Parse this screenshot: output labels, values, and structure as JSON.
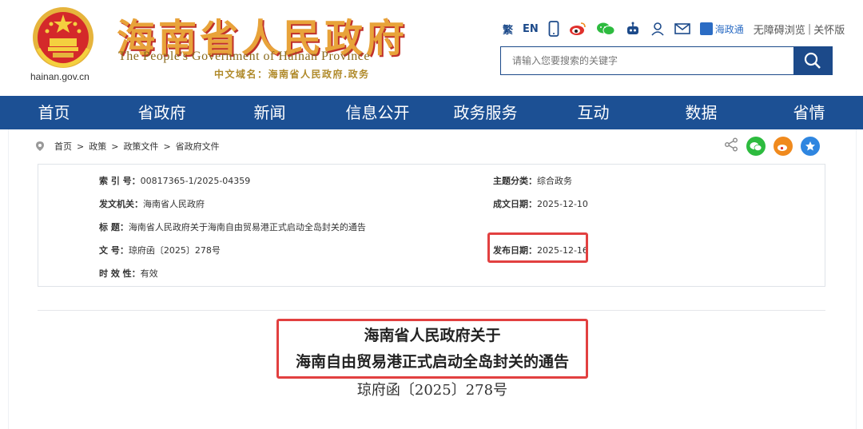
{
  "header": {
    "title_cn": "海南省人民政府",
    "title_en": "The People's Government  of Hainan Province",
    "domain_cn": "中文域名：海南省人民政府.政务",
    "domain_small": "hainan.gov.cn"
  },
  "topbar": {
    "trad": "繁",
    "en": "EN",
    "hzt_label": "海政通",
    "accessibility": "无障碍浏览",
    "separator": "|",
    "elder_mode": "关怀版"
  },
  "search": {
    "placeholder": "请输入您要搜索的关键字"
  },
  "nav": {
    "items": [
      "首页",
      "省政府",
      "新闻",
      "信息公开",
      "政务服务",
      "互动",
      "数据",
      "省情"
    ]
  },
  "breadcrumb": {
    "items": [
      "首页",
      "政策",
      "政策文件",
      "省政府文件"
    ],
    "sep": ">"
  },
  "meta": {
    "index_label": "索  引  号：",
    "index_value": "00817365-1/2025-04359",
    "category_label": "主题分类：",
    "category_value": "综合政务",
    "issuer_label": "发文机关：",
    "issuer_value": "海南省人民政府",
    "date_made_label": "成文日期：",
    "date_made_value": "2025-12-10",
    "title_label": "标    题：",
    "title_value": "海南省人民政府关于海南自由贸易港正式启动全岛封关的通告",
    "docno_label": "文    号：",
    "docno_value": "琼府函〔2025〕278号",
    "pubdate_label": "发布日期：",
    "pubdate_value": "2025-12-16",
    "validity_label": "时  效  性：",
    "validity_value": "有效"
  },
  "document": {
    "title_line1": "海南省人民政府关于",
    "title_line2": "海南自由贸易港正式启动全岛封关的通告",
    "number": "琼府函〔2025〕278号"
  },
  "colors": {
    "nav_bg": "#1c5094",
    "title_gold": "#e8a33a",
    "highlight_red": "#e24040",
    "wechat": "#2dbb3f",
    "weibo": "#f08a1e",
    "star": "#2f86e0"
  }
}
